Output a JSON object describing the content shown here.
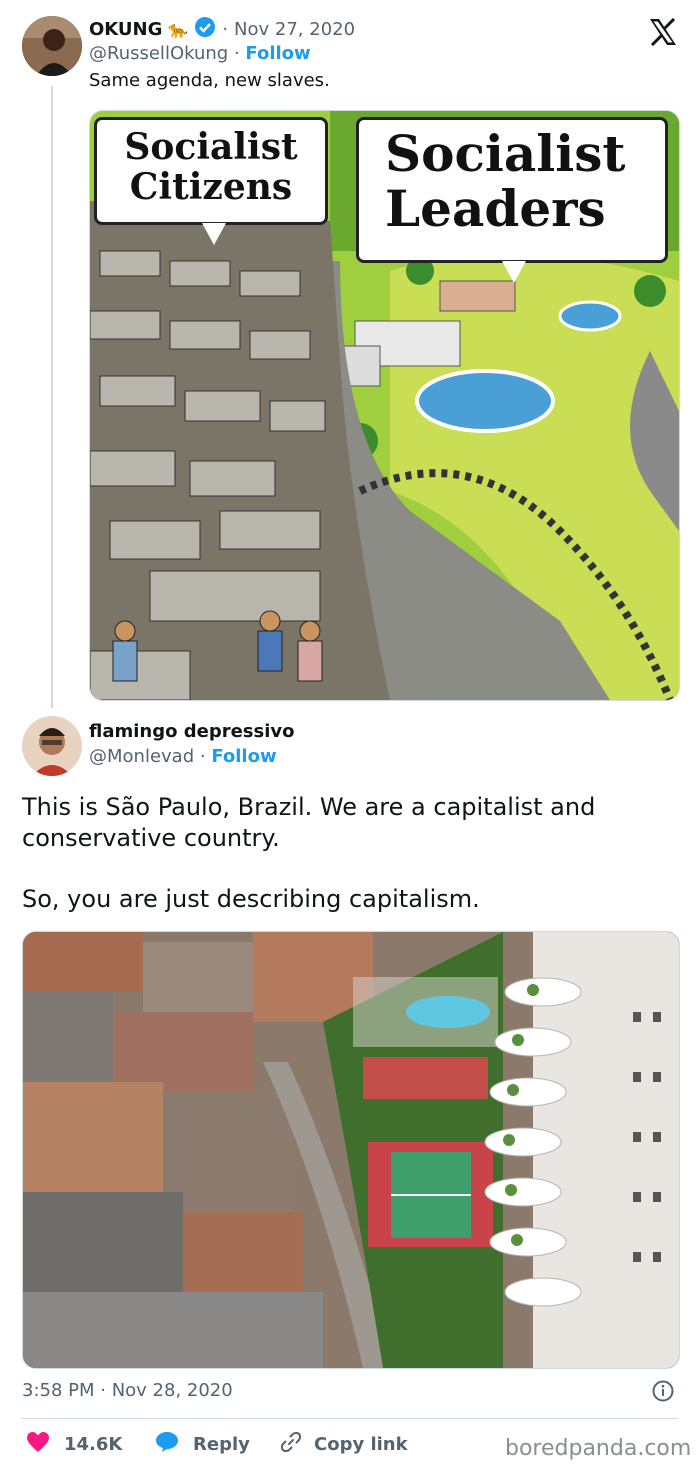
{
  "tweet1": {
    "name": "OKUNG",
    "emoji": "🐆",
    "date": "Nov 27, 2020",
    "handle": "@RussellOkung",
    "follow": "Follow",
    "text": "Same agenda, new slaves.",
    "cartoon": {
      "left_bubble": [
        "Socialist",
        "Citizens"
      ],
      "right_bubble": [
        "Socialist",
        "Leaders"
      ]
    }
  },
  "tweet2": {
    "name": "flamingo depressivo",
    "handle": "@Monlevad",
    "follow": "Follow",
    "text_p1": "This is São Paulo, Brazil. We are a capitalist and conservative country.",
    "text_p2": "So, you are just describing capitalism.",
    "timestamp": "3:58 PM · Nov 28, 2020"
  },
  "actions": {
    "likes": "14.6K",
    "reply": "Reply",
    "copy_link": "Copy link"
  },
  "watermark": "boredpanda.com",
  "colors": {
    "accent": "#1d9bf0",
    "like": "#f91880",
    "muted": "#536471"
  }
}
